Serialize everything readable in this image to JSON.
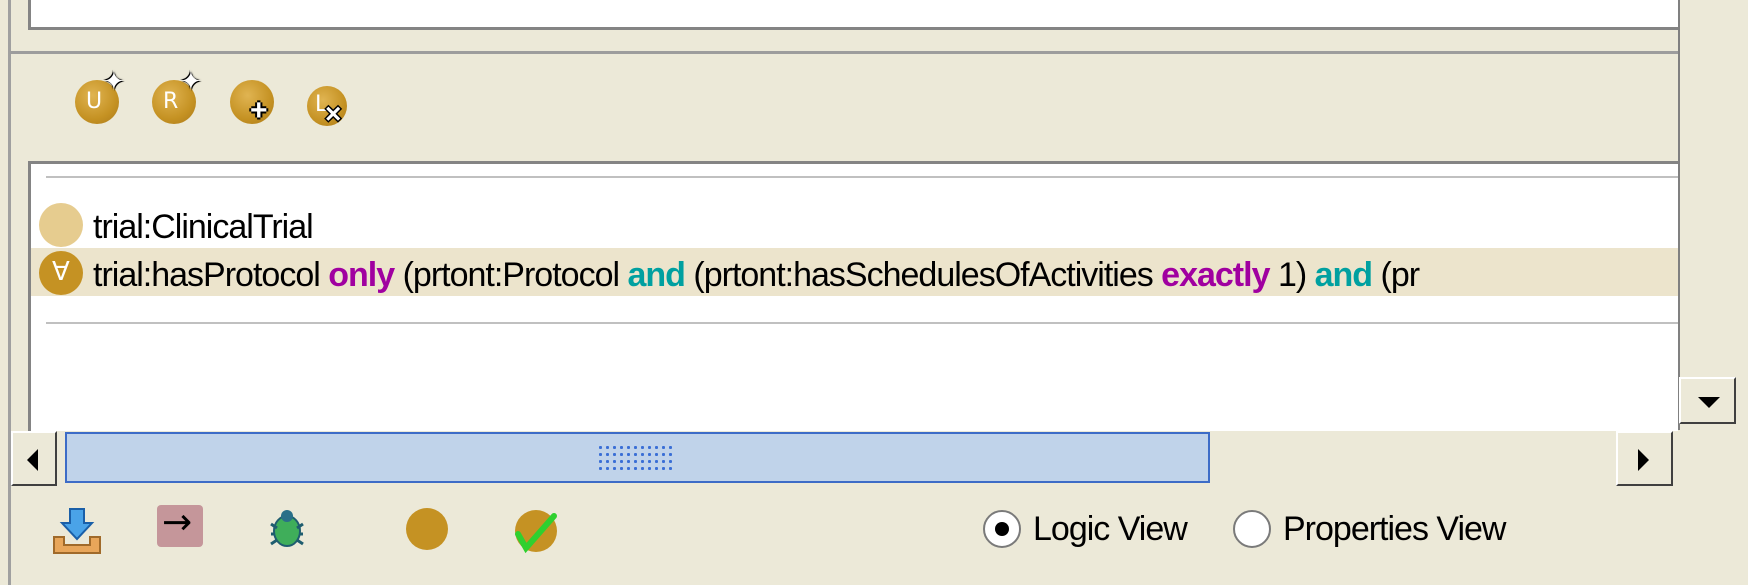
{
  "icon_toolbar": {
    "items": [
      {
        "name": "union-class-add",
        "letter": "U"
      },
      {
        "name": "restriction-class-add",
        "letter": "R"
      },
      {
        "name": "class-add"
      },
      {
        "name": "class-remove",
        "letter": "L"
      }
    ]
  },
  "class_list": {
    "rows": [
      {
        "text": "trial:ClinicalTrial",
        "icon": "named-class-icon"
      },
      {
        "prefix": "trial:hasProtocol ",
        "kw_only": "only",
        "part2": " (prtont:Protocol ",
        "kw_and1": "and",
        "part3": " (prtont:hasSchedulesOfActivities ",
        "kw_exactly": "exactly",
        "part4": " 1) ",
        "kw_and2": "and",
        "part5": " (pr",
        "icon": "restriction-class-icon"
      }
    ]
  },
  "bottom_toolbar": {
    "logic_view_label": "Logic View",
    "properties_view_label": "Properties View",
    "selected_view": "Logic View"
  },
  "colors": {
    "class_icon": "#c59223",
    "keyword_quantifier": "#a000a0",
    "keyword_and": "#00a0a0",
    "selected_row_bg": "#ece4cc"
  }
}
